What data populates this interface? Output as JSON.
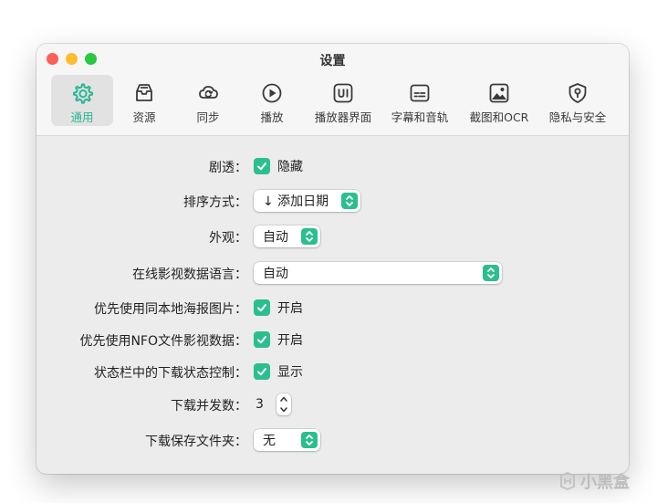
{
  "window": {
    "title": "设置"
  },
  "tabs": [
    {
      "label": "通用",
      "icon": "gear-icon",
      "selected": true
    },
    {
      "label": "资源",
      "icon": "tray-icon"
    },
    {
      "label": "同步",
      "icon": "sync-icon"
    },
    {
      "label": "播放",
      "icon": "play-circle-icon"
    },
    {
      "label": "播放器界面",
      "icon": "ui-icon"
    },
    {
      "label": "字幕和音轨",
      "icon": "subtitles-icon"
    },
    {
      "label": "截图和OCR",
      "icon": "photo-icon"
    },
    {
      "label": "隐私与安全",
      "icon": "shield-lock-icon"
    }
  ],
  "settings": {
    "spoiler": {
      "label": "剧透：",
      "checked": true,
      "text": "隐藏"
    },
    "sort": {
      "label": "排序方式：",
      "value": "↓ 添加日期"
    },
    "appearance": {
      "label": "外观：",
      "value": "自动"
    },
    "language": {
      "label": "在线影视数据语言：",
      "value": "自动"
    },
    "local_poster": {
      "label": "优先使用同本地海报图片：",
      "checked": true,
      "text": "开启"
    },
    "nfo": {
      "label": "优先使用NFO文件影视数据：",
      "checked": true,
      "text": "开启"
    },
    "statusbar": {
      "label": "状态栏中的下载状态控制：",
      "checked": true,
      "text": "显示"
    },
    "concurrency": {
      "label": "下载并发数：",
      "value": "3"
    },
    "folder": {
      "label": "下载保存文件夹：",
      "value": "无"
    }
  },
  "watermark": {
    "text": "小黑盒"
  },
  "colors": {
    "accent": "#2bbf8f",
    "selected_tab_text": "#2bb594"
  }
}
